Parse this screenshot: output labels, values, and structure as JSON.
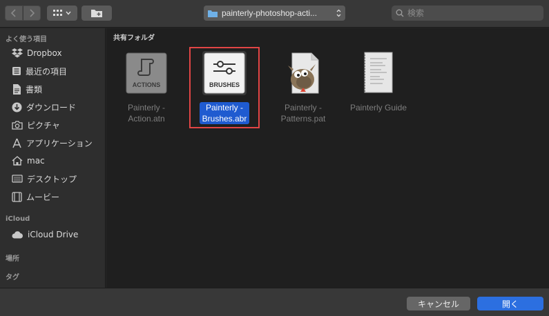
{
  "toolbar": {
    "path_label": "painterly-photoshop-acti...",
    "search_placeholder": "検索"
  },
  "sidebar": {
    "sections": {
      "favorites": "よく使う項目",
      "icloud": "iCloud",
      "locations": "場所",
      "tags": "タグ"
    },
    "items": [
      {
        "label": "Dropbox",
        "icon": "dropbox-icon"
      },
      {
        "label": "最近の項目",
        "icon": "recents-icon"
      },
      {
        "label": "書類",
        "icon": "documents-icon"
      },
      {
        "label": "ダウンロード",
        "icon": "downloads-icon"
      },
      {
        "label": "ピクチャ",
        "icon": "pictures-icon"
      },
      {
        "label": "アプリケーション",
        "icon": "applications-icon"
      },
      {
        "label": "mac",
        "icon": "home-icon"
      },
      {
        "label": "デスクトップ",
        "icon": "desktop-icon"
      },
      {
        "label": "ムービー",
        "icon": "movies-icon"
      },
      {
        "label": "iCloud Drive",
        "icon": "cloud-icon"
      }
    ]
  },
  "main": {
    "breadcrumb": "共有フォルダ",
    "files": [
      {
        "name_line1": "Painterly -",
        "name_line2": "Action.atn",
        "thumb_label": "ACTIONS",
        "selected": false
      },
      {
        "name_line1": "Painterly -",
        "name_line2": "Brushes.abr",
        "thumb_label": "BRUSHES",
        "selected": true
      },
      {
        "name_line1": "Painterly -",
        "name_line2": "Patterns.pat",
        "thumb_label": "",
        "selected": false
      },
      {
        "name_line1": "Painterly Guide",
        "name_line2": "",
        "thumb_label": "",
        "selected": false
      }
    ]
  },
  "footer": {
    "cancel_label": "キャンセル",
    "open_label": "開く"
  },
  "colors": {
    "accent": "#2c6fe0",
    "selection": "#1f5bd0",
    "highlight_box": "#e24545"
  }
}
